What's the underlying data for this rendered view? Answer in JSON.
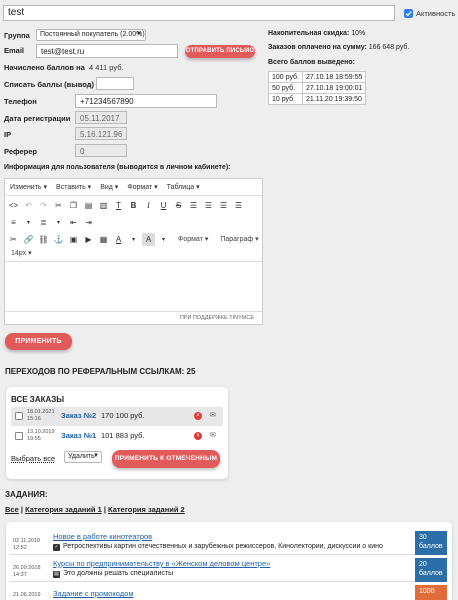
{
  "user": {
    "name": "test",
    "activity_label": "Активность"
  },
  "group": {
    "label": "Группа",
    "value": "Постоянный покупатель (2.00%)"
  },
  "email": {
    "label": "Email",
    "value": "test@test.ru",
    "button": "ОТПРАВИТЬ ПИСЬМО"
  },
  "points": {
    "label": "Начислено баллов на",
    "value": "4 411 руб."
  },
  "writeoff": {
    "label": "Списать баллы (вывод)",
    "sign": "-",
    "value": ""
  },
  "phone": {
    "label": "Телефон",
    "value": "+71234567890"
  },
  "reg_date": {
    "label": "Дата регистрации",
    "value": "05.11.2017"
  },
  "ip": {
    "label": "IP",
    "value": "5.16.121.96"
  },
  "referrer": {
    "label": "Реферер",
    "value": "0"
  },
  "stats": {
    "discount_label": "Накопительная скидка:",
    "discount_value": "10%",
    "orders_label": "Заказов оплачено на сумму:",
    "orders_value": "166 648 руб.",
    "withdrawn_label": "Всего баллов выведено:",
    "withdrawals": [
      {
        "amount": "100 руб.",
        "date": "27.10.18 18:59:55"
      },
      {
        "amount": "50 руб.",
        "date": "27.10.18 19:00:01"
      },
      {
        "amount": "10 руб.",
        "date": "21.11.20 19:39:50"
      }
    ]
  },
  "info": {
    "label": "Информация для пользователя (выводится в личном кабинете):",
    "menu": [
      "Изменить",
      "Вставить",
      "Вид",
      "Формат",
      "Таблица"
    ],
    "format_label": "Формат",
    "paragraph_label": "Параграф",
    "font_size": "14px",
    "powered": "ПРИ ПОДДЕРЖКЕ TINYMCE"
  },
  "apply_button": "ПРИМЕНИТЬ",
  "referrals": {
    "label": "ПЕРЕХОДОВ ПО РЕФЕРАЛЬНЫМ ССЫЛКАМ:",
    "value": "25"
  },
  "orders": {
    "title": "ВСЕ ЗАКАЗЫ",
    "rows": [
      {
        "date": "18.01.2021",
        "time": "15:16",
        "name": "Заказ №2",
        "sum": "170 100 руб."
      },
      {
        "date": "13.10.2019",
        "time": "19:55",
        "name": "Заказ №1",
        "sum": "101 883 руб."
      }
    ],
    "select_all": "Выбрать все",
    "action": "Удалить",
    "apply": "ПРИМЕНИТЬ К ОТМЕЧЕННЫМ"
  },
  "tasks": {
    "title": "ЗАДАНИЯ:",
    "filters": [
      "Все",
      "Категория заданий 1",
      "Категория заданий 2"
    ],
    "separator": "|",
    "items": [
      {
        "date": "02.11.2018",
        "time": "12:52",
        "title": "Новое в работе кинотеатров",
        "desc": "Ретроспективы картин отечественных и зарубежных режиссеров, Кинолектории, дискуссии о кино",
        "badge": "30\nбаллов",
        "badge_color": "#2b6ea8",
        "icon": "check"
      },
      {
        "date": "26.09.2018",
        "time": "14:37",
        "title": "Курсы по предпринимательству в «Женском деловом центре»",
        "desc": "Это должны решать специалисты",
        "badge": "20\nбаллов",
        "badge_color": "#2b6ea8",
        "icon": "doc"
      },
      {
        "date": "21.06.2019",
        "time": "",
        "title": "Задание с промокодом",
        "desc": "",
        "badge": "1000",
        "badge_color": "#e06c3c",
        "icon": ""
      }
    ]
  },
  "colors": {
    "accent": "#e25a5a",
    "link": "#1e5ea8",
    "badge_blue": "#2b6ea8",
    "badge_orange": "#e06c3c"
  }
}
